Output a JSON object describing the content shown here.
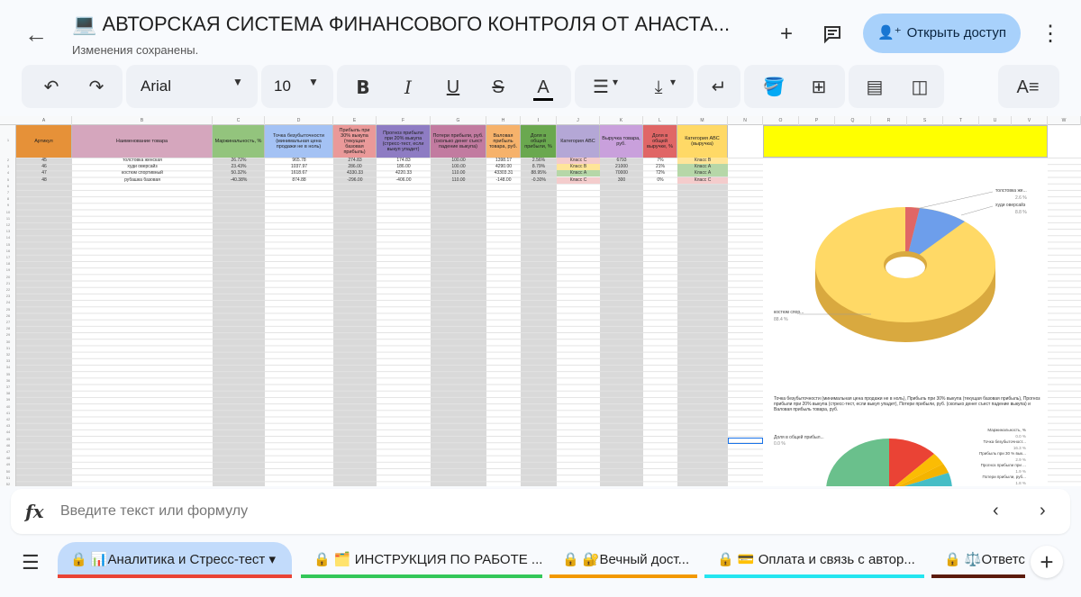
{
  "header": {
    "title": "💻 АВТОРСКАЯ СИСТЕМА ФИНАНСОВОГО КОНТРОЛЯ ОТ АНАСТА...",
    "subtitle": "Изменения сохранены.",
    "share_label": "Открыть доступ",
    "back_icon": "arrow-back-icon",
    "add_icon": "plus-icon",
    "comment_icon": "comment-icon",
    "more_icon": "more-vert-icon"
  },
  "toolbar": {
    "font": "Arial",
    "font_size": "10"
  },
  "sheet": {
    "column_letters": [
      "A",
      "B",
      "C",
      "D",
      "E",
      "F",
      "G",
      "H",
      "I",
      "J",
      "K",
      "L",
      "M",
      "N",
      "O",
      "P",
      "Q",
      "R",
      "S",
      "T",
      "U",
      "V",
      "W"
    ],
    "headers": [
      {
        "text": "Артикул",
        "color": "#e69138"
      },
      {
        "text": "Наименование товара",
        "color": "#d5a6bd"
      },
      {
        "text": "Маржинальность, %",
        "color": "#93c47d"
      },
      {
        "text": "Точка безубыточности (минимальная цена продажи не в ноль)",
        "color": "#a4c2f4"
      },
      {
        "text": "Прибыль при 30% выкупа (текущая базовая прибыль)",
        "color": "#ea9999"
      },
      {
        "text": "Прогноз прибыли при 20% выкупа (стресс-тест, если выкуп упадет)",
        "color": "#8e7cc3"
      },
      {
        "text": "Потери прибыли, руб. (сколько денег съест падение выкупа)",
        "color": "#c27ba0"
      },
      {
        "text": "Валовая прибыль товара, руб.",
        "color": "#f6b26b"
      },
      {
        "text": "Доля в общей прибыли, %",
        "color": "#6aa84f"
      },
      {
        "text": "Категория ABC",
        "color": "#b4a7d6"
      },
      {
        "text": "Выручка товара, руб.",
        "color": "#c9a0dc"
      },
      {
        "text": "Доля в общей выручке, %",
        "color": "#e06666"
      },
      {
        "text": "Категория ABC (выручка)",
        "color": "#ffd966"
      }
    ],
    "rows": [
      [
        "45",
        "толстовка женская",
        "26.72%",
        "965.78",
        "274.83",
        "174.83",
        "100.00",
        "1398.17",
        "2.56%",
        "Класс C",
        "6793",
        "7%",
        "Класс B"
      ],
      [
        "46",
        "худи оверсайз",
        "23.43%",
        "1037.97",
        "286.00",
        "186.00",
        "100.00",
        "4290.00",
        "8.79%",
        "Класс B",
        "21000",
        "21%",
        "Класс A"
      ],
      [
        "47",
        "костюм спортивный",
        "50.32%",
        "1618.67",
        "4330.33",
        "4220.33",
        "110.00",
        "43303.31",
        "88.95%",
        "Класс A",
        "70000",
        "72%",
        "Класс A"
      ],
      [
        "48",
        "рубашка базовая",
        "-40.38%",
        "874.88",
        "-296.00",
        "-406.00",
        "110.00",
        "-148.00",
        "-0.30%",
        "Класс C",
        "300",
        "0%",
        "Класс C"
      ]
    ]
  },
  "chart1": {
    "labels": [
      {
        "name": "толстовка же...",
        "pct": "2.6 %"
      },
      {
        "name": "худи оверсайз",
        "pct": "8.8 %"
      },
      {
        "name": "костюм спор...",
        "pct": "88.4 %"
      }
    ]
  },
  "chart2": {
    "title": "Точка безубыточности (минимальная цена продажи не в ноль), Прибыль при 30% выкупа (текущая базовая прибыль), Прогноз прибыли при 20% выкупа (стресс-тест, если выкуп упадет), Потери прибыли, руб. (сколько денег съест падение выкупа) и Валовая прибыль товара, руб.",
    "labels": [
      {
        "name": "Маржинальность, %",
        "pct": "0.0 %"
      },
      {
        "name": "Точка безубыточност...",
        "pct": "16.3 %"
      },
      {
        "name": "Прибыль при 30 % вык...",
        "pct": "2.9 %"
      },
      {
        "name": "Прогноз прибыли при ...",
        "pct": "1.9 %"
      },
      {
        "name": "Потери прибыли, руб...",
        "pct": "1.8 %"
      },
      {
        "name": "Доля в общей прибыл...",
        "pct": "0.0 %"
      }
    ]
  },
  "formula_bar": {
    "fx": "fx",
    "placeholder": "Введите текст или формулу"
  },
  "tabs": [
    {
      "label": "📊Аналитика и Стресс-тест",
      "color": "#ea4335",
      "active": true
    },
    {
      "label": "🗂️ ИНСТРУКЦИЯ ПО РАБОТЕ ...",
      "color": "#34c759"
    },
    {
      "label": "🔐Вечный дост...",
      "color": "#f29900"
    },
    {
      "label": "💳 Оплата и связь с автор...",
      "color": "#24e5f0"
    },
    {
      "label": "⚖️Ответст",
      "color": "#5b1a0c"
    }
  ]
}
